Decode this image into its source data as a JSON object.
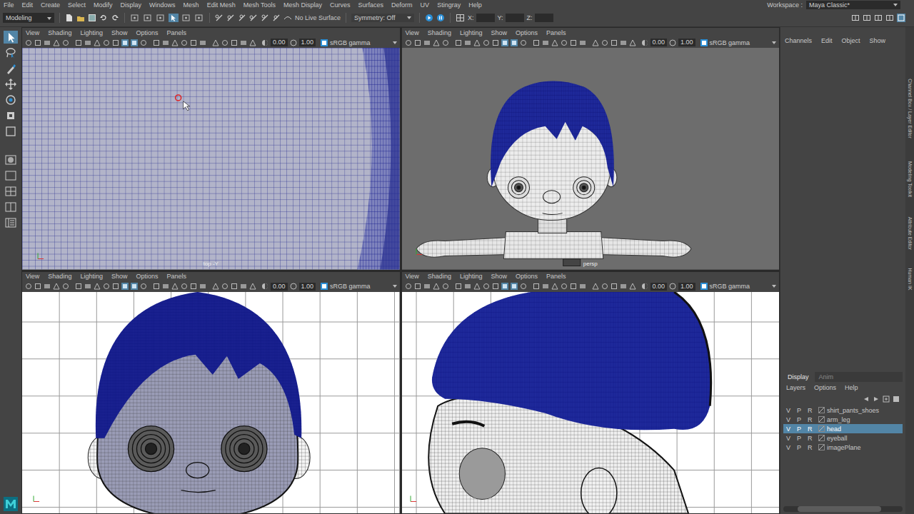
{
  "menubar": {
    "items": [
      "File",
      "Edit",
      "Create",
      "Select",
      "Modify",
      "Display",
      "Windows",
      "Mesh",
      "Edit Mesh",
      "Mesh Tools",
      "Mesh Display",
      "Curves",
      "Surfaces",
      "Deform",
      "UV",
      "Stingray",
      "Help"
    ]
  },
  "workspace": {
    "label": "Workspace :",
    "value": "Maya Classic*"
  },
  "status_line": {
    "menu_set": "Modeling",
    "live_surface": "No Live Surface",
    "symmetry": "Symmetry: Off",
    "coordinates": [
      "X:",
      "Y:",
      "Z:"
    ]
  },
  "viewports": [
    {
      "menu": [
        "View",
        "Shading",
        "Lighting",
        "Show",
        "Options",
        "Panels"
      ],
      "exposure": "0.00",
      "gamma": "1.00",
      "color_space": "sRGB gamma",
      "camera": "top -Y",
      "kind": "mesh"
    },
    {
      "menu": [
        "View",
        "Shading",
        "Lighting",
        "Show",
        "Options",
        "Panels"
      ],
      "exposure": "0.00",
      "gamma": "1.00",
      "color_space": "sRGB gamma",
      "camera": "persp",
      "kind": "persp"
    },
    {
      "menu": [
        "View",
        "Shading",
        "Lighting",
        "Show",
        "Options",
        "Panels"
      ],
      "exposure": "0.00",
      "gamma": "1.00",
      "color_space": "sRGB gamma",
      "kind": "front"
    },
    {
      "menu": [
        "View",
        "Shading",
        "Lighting",
        "Show",
        "Options",
        "Panels"
      ],
      "exposure": "0.00",
      "gamma": "1.00",
      "color_space": "sRGB gamma",
      "kind": "side"
    }
  ],
  "channel_box": {
    "menu": [
      "Channels",
      "Edit",
      "Object",
      "Show"
    ]
  },
  "layer_editor": {
    "tabs": [
      {
        "label": "Display",
        "selected": true
      },
      {
        "label": "Anim",
        "selected": false
      }
    ],
    "menu": [
      "Layers",
      "Options",
      "Help"
    ],
    "layers": [
      {
        "visible": "V",
        "playback": "P",
        "reference": "R",
        "name": "shirt_pants_shoes",
        "selected": false
      },
      {
        "visible": "V",
        "playback": "P",
        "reference": "R",
        "name": "arm_leg",
        "selected": false
      },
      {
        "visible": "V",
        "playback": "P",
        "reference": "R",
        "name": "head",
        "selected": true
      },
      {
        "visible": "V",
        "playback": "P",
        "reference": "R",
        "name": "eyeball",
        "selected": false
      },
      {
        "visible": "V",
        "playback": "P",
        "reference": "R",
        "name": "imagePlane",
        "selected": false
      }
    ]
  },
  "side_tabs": [
    "Channel Box / Layer Editor",
    "Modeling Toolkit",
    "Attribute Editor",
    "Human IK"
  ]
}
